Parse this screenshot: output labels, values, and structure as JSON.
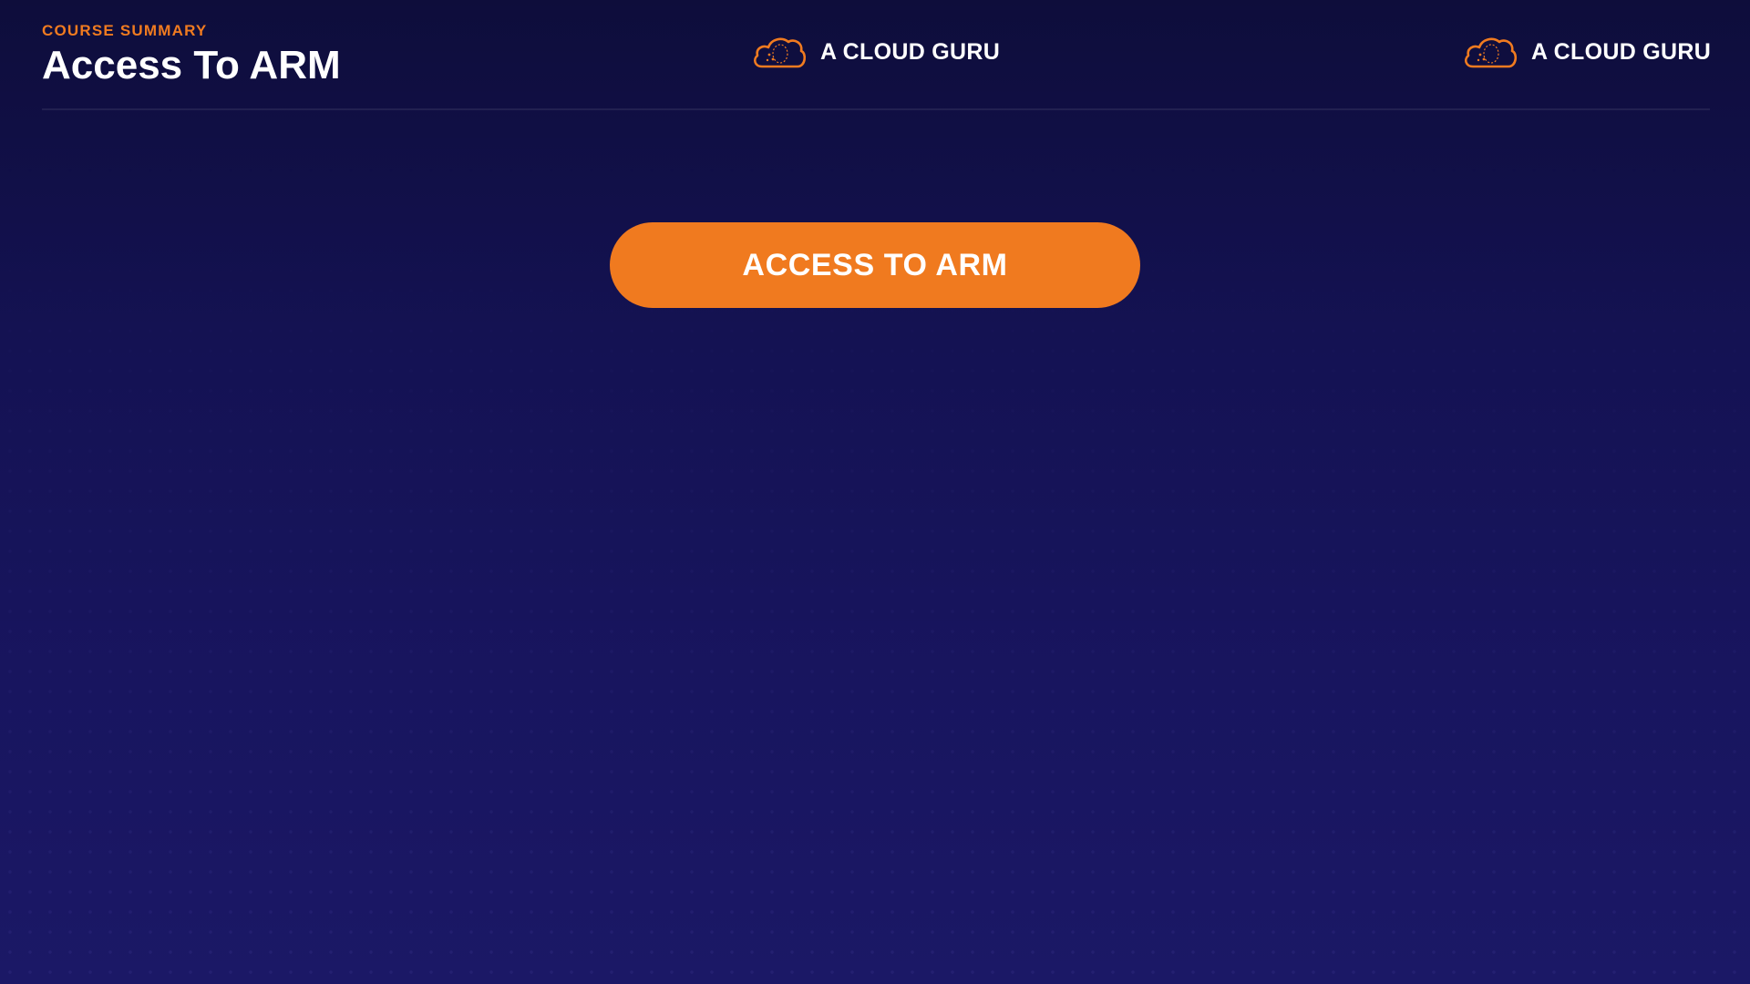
{
  "slide": {
    "eyebrow": "COURSE SUMMARY",
    "title": "Access To ARM"
  },
  "logos": [
    {
      "text": "A CLOUD GURU",
      "icon": "cloud-icon"
    },
    {
      "text": "A CLOUD GURU",
      "icon": "cloud-icon"
    }
  ],
  "cta": {
    "label": "ACCESS TO ARM"
  },
  "colors": {
    "accent": "#f07a1f",
    "background": "#141253",
    "text": "#ffffff"
  }
}
